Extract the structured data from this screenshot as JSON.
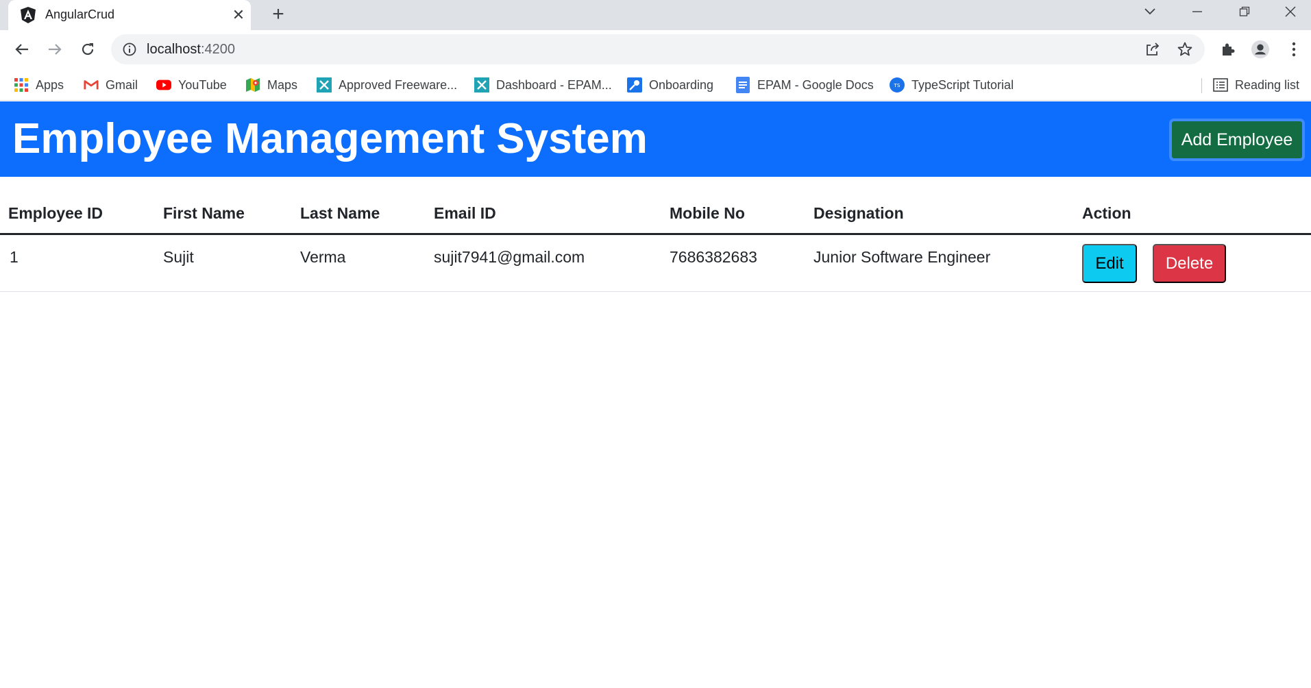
{
  "browser": {
    "tab_title": "AngularCrud",
    "url_host": "localhost",
    "url_port": ":4200",
    "bookmarks": [
      {
        "label": "Apps",
        "icon": "apps-grid-icon"
      },
      {
        "label": "Gmail",
        "icon": "gmail-icon"
      },
      {
        "label": "YouTube",
        "icon": "youtube-icon"
      },
      {
        "label": "Maps",
        "icon": "maps-icon"
      },
      {
        "label": "Approved Freeware...",
        "icon": "epam-icon"
      },
      {
        "label": "Dashboard - EPAM...",
        "icon": "epam-icon"
      },
      {
        "label": "Onboarding",
        "icon": "key-icon"
      },
      {
        "label": "EPAM - Google Docs",
        "icon": "google-docs-icon"
      },
      {
        "label": "TypeScript Tutorial",
        "icon": "typescript-icon"
      }
    ],
    "reading_list": "Reading list"
  },
  "app": {
    "title": "Employee Management System",
    "add_button": "Add Employee",
    "columns": [
      "Employee ID",
      "First Name",
      "Last Name",
      "Email ID",
      "Mobile No",
      "Designation",
      "Action"
    ],
    "rows": [
      {
        "id": "1",
        "first_name": "Sujit",
        "last_name": "Verma",
        "email": "sujit7941@gmail.com",
        "mobile": "7686382683",
        "designation": "Junior Software Engineer",
        "edit_label": "Edit",
        "delete_label": "Delete"
      }
    ]
  },
  "colors": {
    "header_bg": "#0d6efd",
    "add_button": "#146c43",
    "edit_button": "#0dcaf0",
    "delete_button": "#dc3545"
  }
}
